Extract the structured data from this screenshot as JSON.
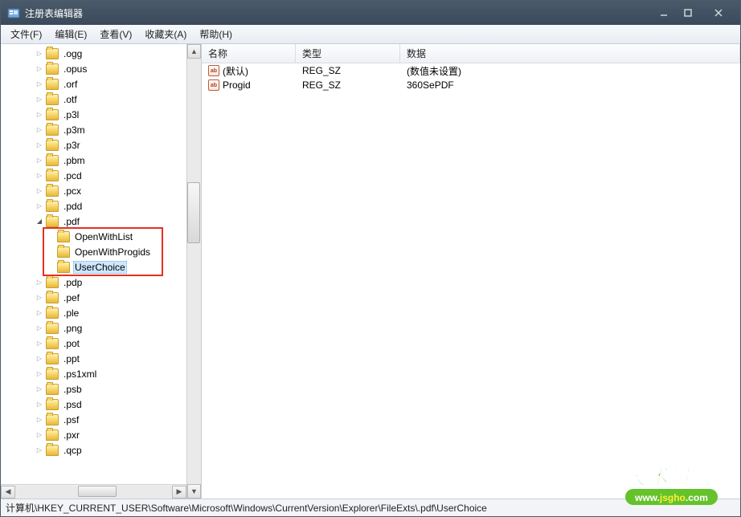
{
  "window": {
    "title": "注册表编辑器"
  },
  "menu": {
    "file": "文件(F)",
    "edit": "编辑(E)",
    "view": "查看(V)",
    "favorites": "收藏夹(A)",
    "help": "帮助(H)"
  },
  "tree": {
    "items": [
      {
        "label": ".ogg",
        "depth": 3,
        "toggle": "collapsed"
      },
      {
        "label": ".opus",
        "depth": 3,
        "toggle": "collapsed"
      },
      {
        "label": ".orf",
        "depth": 3,
        "toggle": "collapsed"
      },
      {
        "label": ".otf",
        "depth": 3,
        "toggle": "collapsed"
      },
      {
        "label": ".p3l",
        "depth": 3,
        "toggle": "collapsed"
      },
      {
        "label": ".p3m",
        "depth": 3,
        "toggle": "collapsed"
      },
      {
        "label": ".p3r",
        "depth": 3,
        "toggle": "collapsed"
      },
      {
        "label": ".pbm",
        "depth": 3,
        "toggle": "collapsed"
      },
      {
        "label": ".pcd",
        "depth": 3,
        "toggle": "collapsed"
      },
      {
        "label": ".pcx",
        "depth": 3,
        "toggle": "collapsed"
      },
      {
        "label": ".pdd",
        "depth": 3,
        "toggle": "collapsed"
      },
      {
        "label": ".pdf",
        "depth": 3,
        "toggle": "expanded"
      },
      {
        "label": "OpenWithList",
        "depth": 4,
        "toggle": "none"
      },
      {
        "label": "OpenWithProgids",
        "depth": 4,
        "toggle": "none"
      },
      {
        "label": "UserChoice",
        "depth": 4,
        "toggle": "none",
        "selected": true
      },
      {
        "label": ".pdp",
        "depth": 3,
        "toggle": "collapsed"
      },
      {
        "label": ".pef",
        "depth": 3,
        "toggle": "collapsed"
      },
      {
        "label": ".ple",
        "depth": 3,
        "toggle": "collapsed"
      },
      {
        "label": ".png",
        "depth": 3,
        "toggle": "collapsed"
      },
      {
        "label": ".pot",
        "depth": 3,
        "toggle": "collapsed"
      },
      {
        "label": ".ppt",
        "depth": 3,
        "toggle": "collapsed"
      },
      {
        "label": ".ps1xml",
        "depth": 3,
        "toggle": "collapsed"
      },
      {
        "label": ".psb",
        "depth": 3,
        "toggle": "collapsed"
      },
      {
        "label": ".psd",
        "depth": 3,
        "toggle": "collapsed"
      },
      {
        "label": ".psf",
        "depth": 3,
        "toggle": "collapsed"
      },
      {
        "label": ".pxr",
        "depth": 3,
        "toggle": "collapsed"
      },
      {
        "label": ".qcp",
        "depth": 3,
        "toggle": "collapsed"
      }
    ]
  },
  "list": {
    "headers": {
      "name": "名称",
      "type": "类型",
      "data": "数据"
    },
    "rows": [
      {
        "name": "(默认)",
        "type": "REG_SZ",
        "data": "(数值未设置)"
      },
      {
        "name": "Progid",
        "type": "REG_SZ",
        "data": "360SePDF"
      }
    ]
  },
  "statusbar": {
    "path": "计算机\\HKEY_CURRENT_USER\\Software\\Microsoft\\Windows\\CurrentVersion\\Explorer\\FileExts\\.pdf\\UserChoice"
  },
  "watermark": {
    "top": "技术员联盟",
    "bot_prefix": "www.",
    "bot_mid": "jsgho",
    "bot_suffix": ".com"
  }
}
